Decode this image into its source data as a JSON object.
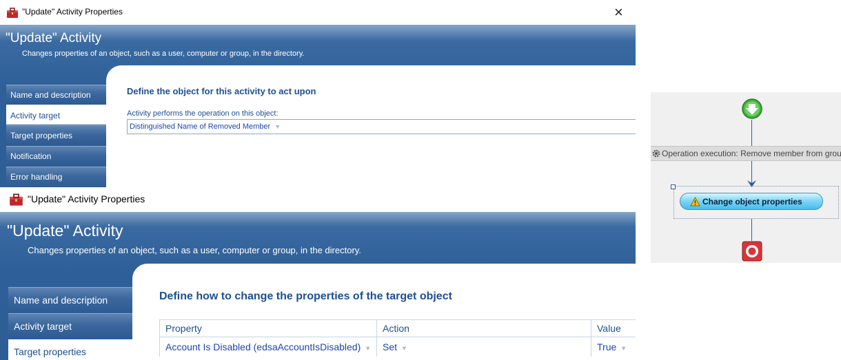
{
  "dialog_top": {
    "title": "\"Update\" Activity Properties",
    "close_glyph": "×",
    "header_title": "\"Update\" Activity",
    "header_subtitle": "Changes properties of an object, such as a user, computer or group, in the directory.",
    "sidebar": [
      {
        "label": "Name and description",
        "selected": false
      },
      {
        "label": "Activity target",
        "selected": true
      },
      {
        "label": "Target properties",
        "selected": false
      },
      {
        "label": "Notification",
        "selected": false
      },
      {
        "label": "Error handling",
        "selected": false
      }
    ],
    "section_title": "Define the object for this activity to act upon",
    "target_label": "Activity performs the operation on this object:",
    "target_value": "Distinguished Name of Removed Member"
  },
  "dialog_bottom": {
    "title": "\"Update\" Activity Properties",
    "header_title": "\"Update\" Activity",
    "header_subtitle": "Changes properties of an object, such as a user, computer or group, in the directory.",
    "sidebar": [
      {
        "label": "Name and description",
        "selected": false
      },
      {
        "label": "Activity target",
        "selected": false
      },
      {
        "label": "Target properties",
        "selected": true
      }
    ],
    "section_title": "Define how to change the properties of the target object",
    "table": {
      "headers": [
        "Property",
        "Action",
        "Value"
      ],
      "rows": [
        [
          "Account Is Disabled (edsaAccountIsDisabled)",
          "Set",
          "True"
        ]
      ]
    }
  },
  "workflow": {
    "operation_label": "Operation execution: Remove member from group",
    "activity_label": "Change object properties",
    "icons": [
      "start-arrow-icon",
      "gear-icon",
      "warning-triangle-icon",
      "stop-icon"
    ]
  },
  "colors": {
    "header_blue": "#2f5f98",
    "accent_text": "#1d4f8f",
    "link_text": "#1a46b0",
    "start_green": "#3fb13a",
    "stop_red": "#d8343a",
    "pill_cyan": "#45bde9"
  }
}
